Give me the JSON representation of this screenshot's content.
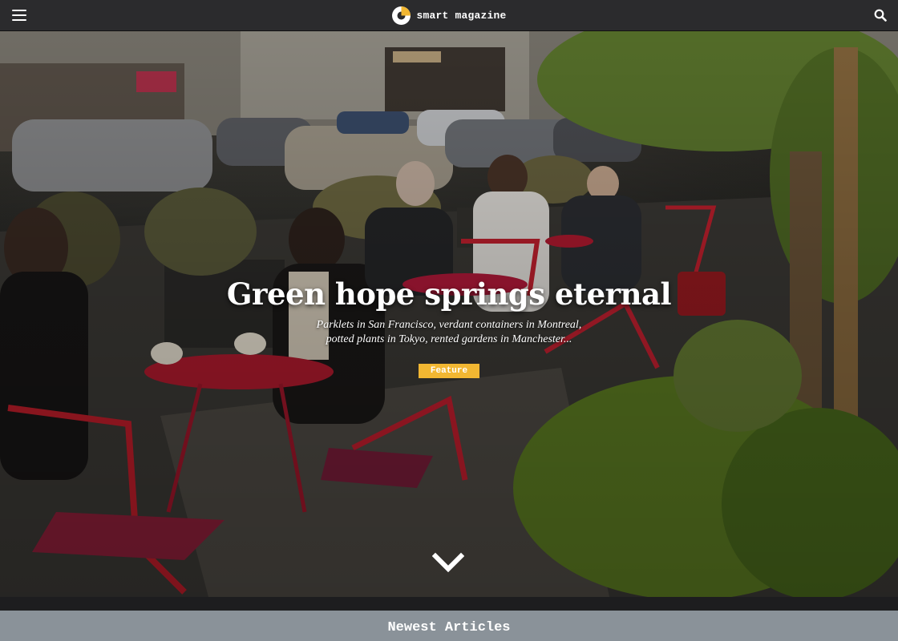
{
  "header": {
    "brand_name": "smart magazine",
    "menu_icon": "hamburger-menu-icon",
    "search_icon": "search-icon",
    "logo_icon": "smart-logo-icon",
    "logo_color": "#f2b732"
  },
  "hero": {
    "title": "Green hope springs eternal",
    "subtitle": "Parklets in San Francisco, verdant containers in Montreal, potted plants in Tokyo, rented gardens in Manchester...",
    "badge": "Feature",
    "badge_color": "#f2b732",
    "scroll_icon": "chevron-down-icon"
  },
  "newest": {
    "title": "Newest Articles"
  }
}
